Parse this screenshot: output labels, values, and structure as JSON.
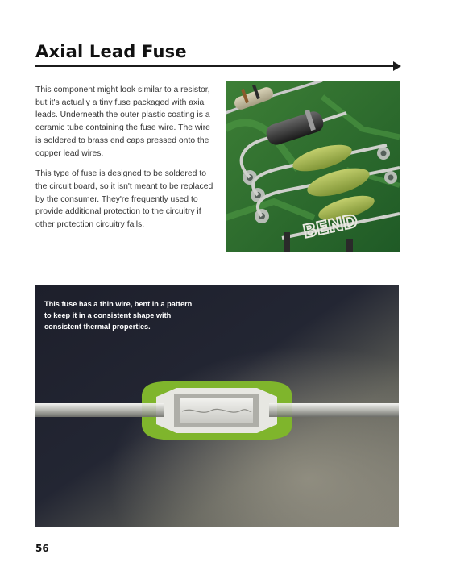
{
  "page": {
    "title": "Axial Lead Fuse",
    "paragraphs": [
      "This component might look similar to a resistor, but it's actually a tiny fuse packaged with axial leads. Underneath the outer plastic coating is a ceramic tube containing the fuse wire. The wire is soldered to brass end caps pressed onto the copper lead wires.",
      "This type of fuse is designed to be soldered to the circuit board, so it isn't meant to be replaced by the consumer. They're frequently used to provide additional protection to the circuitry if other protection circuitry fails."
    ],
    "caption": "This fuse has a thin wire, bent in a pattern to keep it in a consistent shape with consistent thermal properties.",
    "page_number": "56"
  },
  "photo_top": {
    "board_label": "BEND"
  },
  "colors": {
    "board_green": "#2d6a2f",
    "fuse_green": "#9cb24a",
    "xray_background": "#1c1f2a",
    "xray_green": "#7fb52c"
  }
}
